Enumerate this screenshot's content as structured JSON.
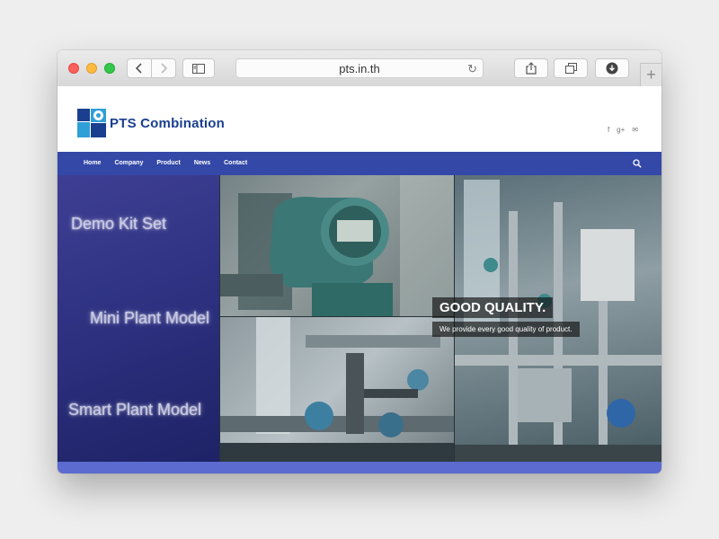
{
  "browser": {
    "url": "pts.in.th",
    "back_icon": "chevron-left-icon",
    "forward_icon": "chevron-right-icon",
    "new_tab_label": "+"
  },
  "site": {
    "logo_text": "PTS Combination",
    "social": [
      "f",
      "g+",
      "✉"
    ],
    "nav": [
      "Home",
      "Company",
      "Product",
      "News",
      "Contact"
    ],
    "hero": {
      "side_items": [
        "Demo Kit Set",
        "Mini Plant Model",
        "Smart Plant Model"
      ],
      "caption_title": "GOOD QUALITY.",
      "caption_sub": "We provide every good quality of product."
    }
  },
  "colors": {
    "nav_bg": "#3448a8",
    "brand_blue": "#1b3f8f",
    "footer_band": "#5b6bd0"
  }
}
